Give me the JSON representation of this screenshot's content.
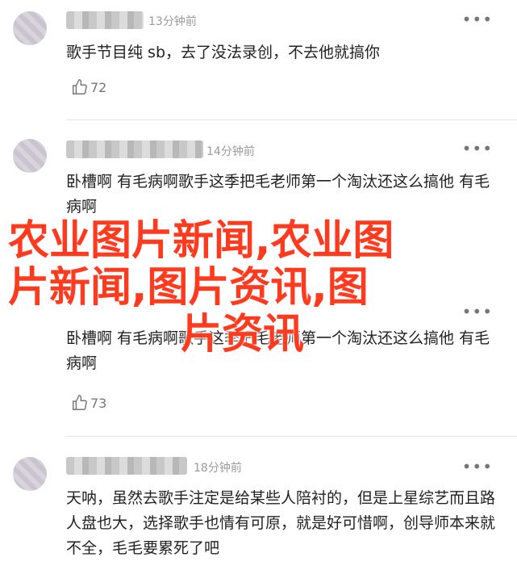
{
  "comments": [
    {
      "time": "13分钟前",
      "text": "歌手节目纯 sb，去了没法录创，不去他就搞你",
      "likes": "72"
    },
    {
      "time": "14分钟前",
      "text": "卧槽啊 有毛病啊歌手这季把毛老师第一个淘汰还这么搞他 有毛病啊"
    },
    {
      "text": "卧槽啊 有毛病啊歌手这季把毛老师第一个淘汰还这么搞他 有毛病啊",
      "likes": "73"
    },
    {
      "time": "18分钟前",
      "text": "天呐，虽然去歌手注定是给某些人陪衬的，但是上星综艺而且路人盘也大，选择歌手也情有可原，就是好可惜啊，创导师本来就不全，毛毛要累死了吧"
    }
  ],
  "more_label": "•••",
  "watermark": {
    "line1": "农业图片新闻,农业图",
    "line2": "片新闻,图片资讯,图",
    "line3": "片资讯"
  }
}
